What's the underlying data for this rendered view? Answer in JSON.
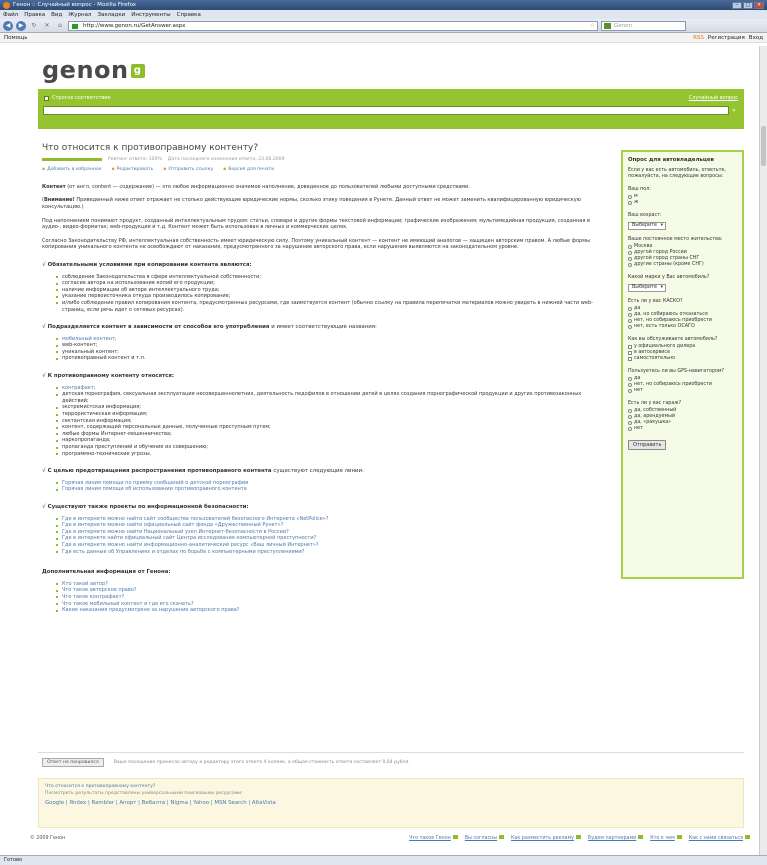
{
  "browser": {
    "window_title": "Генон :: Случайный вопрос - Mozilla Firefox",
    "menu": [
      "Файл",
      "Правка",
      "Вид",
      "Журнал",
      "Закладки",
      "Инструменты",
      "Справка"
    ],
    "url": "http://www.genon.ru/GetAnswer.aspx",
    "search_placeholder": "Genon",
    "status": "Готово"
  },
  "sitebar": {
    "help": "Помощь",
    "rss": "RSS",
    "register": "Регистрация",
    "login": "Вход"
  },
  "header": {
    "logo": "genon",
    "logo_mark": "g",
    "strict": "Строгое соответствие",
    "random": "Случайный вопрос"
  },
  "article": {
    "title": "Что относится к противоправному контенту?",
    "rating_text": "Рейтинг ответа: 100%",
    "updated": "Дата последнего изменения ответа: 23.06.2009",
    "actions": [
      "Добавить в избранное",
      "Редактировать",
      "Отправить ссылку",
      "Версия для печати"
    ],
    "intro_bold": "Контент",
    "intro": "(от англ. content — содержание) — это любое информационно значимое наполнение, доведенное до пользователей любыми доступными средствами.",
    "warning_bold": "Внимание!",
    "warning": "Приведенный ниже ответ отражает не столько действующие юридические нормы, сколько этику поведения в Рунете. Данный ответ не может заменить квалифицированную юридическую консультацию.)",
    "p3": "Под наполнением понимают продукт, созданный интеллектуальным трудом: статьи, словари и другие формы текстовой информации; графические изображения; мультимедийная продукция, созданная в аудио-, видео-форматах; web-продукция и т.д. Контент может быть использован в личных и коммерческих целях.",
    "p4": "Согласно Законодательству РФ, интеллектуальная собственность имеет юридическую силу. Поэтому уникальный контент — контент не имеющий аналогов — защищен авторским правом. А любые формы копирования уникального контента не освобождают от наказания, предусмотренного за нарушение авторского права, если нарушения выявляются на законодательном уровне.",
    "s1": "Обязательными условиями при копировании контента являются:",
    "s1_items": [
      "соблюдение Законодательства в сфере интеллектуальной собственности;",
      "согласие автора на использование копий его продукции;",
      "наличие информации об авторе интеллектуального труда;",
      "указание первоисточника откуда производилось копирование;",
      "и/либо соблюдение правил копирования контента, предусмотренных ресурсами, где заимствуется контент (обычно ссылку на правила перепечатки материалов можно увидеть в нижней части web-страниц, если речь идет о сетевых ресурсах)."
    ],
    "s2": "Подразделяется контент в зависимости от способов его употребления",
    "s2_tail": "и имеет соответствующие названия:",
    "s2_items": [
      "мобильный контент;",
      "web-контент;",
      "уникальный контент;",
      "противоправный контент и т.п."
    ],
    "s3": "К противоправному контенту относятся:",
    "s3_items": [
      "контрафакт;",
      "детская порнография, сексуальная эксплуатация несовершеннолетних, деятельность педофилов в отношении детей в целях создания порнографической продукции и других противозаконных действий;",
      "экстремистская информация;",
      "террористическая информация;",
      "сектантская информация;",
      "контент, содержащий персональные данные, полученные преступным путем;",
      "любые формы Интернет-мошенничества;",
      "наркопропаганда;",
      "пропаганда преступлений и обучение их совершению;",
      "программно-технические угрозы."
    ],
    "s4": "С целью предотвращения распространения противоправного контента",
    "s4_tail": "существуют следующие линии:",
    "s4_items": [
      "Горячая линия помощи по приему сообщений о детской порнографии",
      "Горячая линия помощи об использовании противоправного контента"
    ],
    "s5": "Существуют также проекты по информационной безопасности:",
    "s5_items": [
      "Где в интернете можно найти сайт сообщества пользователей безопасного Интернета «NetPolice»?",
      "Где в интернете можно найти официальный сайт фонда «Дружественный Рунет»?",
      "Где в интернете можно найти Национальный узел Интернет-безопасности в России?",
      "Где в интернете найти официальный сайт Центра исследования компьютерной преступности?",
      "Где в интернете можно найти информационно-аналитический ресурс «Ваш личный Интернет»?",
      "Где есть данные об Управлениях и отделах по борьбе с компьютерными преступлениями?"
    ],
    "extra": "Дополнительная информация от Генона:",
    "extra_items": [
      "Кто такой автор?",
      "Что такое авторское право?",
      "Что такое контрафакт?",
      "Что такое мобильный контент и где его скачать?",
      "Какие наказания предусмотрено за нарушение авторского права?"
    ]
  },
  "poll": {
    "title": "Опрос для автовладельцев",
    "intro": "Если у вас есть автомобиль, ответьте, пожалуйста, на следующие вопросы:",
    "q_gender": "Ваш пол:",
    "gender": [
      "м",
      "ж"
    ],
    "q_age": "Ваш возраст:",
    "select": "Выберите",
    "q_city": "Ваше постоянное место жительства:",
    "city": [
      "Москва",
      "другой город России",
      "другой город страны СНГ",
      "другие страны (кроме СНГ)"
    ],
    "q_brand": "Какой марки у Вас автомобиль?",
    "q_kasko": "Есть ли у вас КАСКО?",
    "kasko": [
      "да",
      "да, но собираюсь отказаться",
      "нет, но собираюсь приобрести",
      "нет, есть только ОСАГО"
    ],
    "q_service": "Как вы обслуживаете автомобиль?",
    "service": [
      "у официального дилера",
      "в автосервисе",
      "самостоятельно"
    ],
    "q_gps": "Пользуетесь ли вы GPS-навигатором?",
    "gps": [
      "да",
      "нет, но собираюсь приобрести",
      "нет"
    ],
    "q_garage": "Есть ли у вас гараж?",
    "garage": [
      "да, собственный",
      "да, арендуемый",
      "да, «ракушка»",
      "нет"
    ],
    "submit": "Отправить"
  },
  "bottom": {
    "reply_btn": "Ответ не понравился",
    "reply_text": "Ваше посещение принесло автору и редактору этого ответа 4 копеек, а общая стоимость ответа составляет 0,64 рубля.",
    "y1": "Что относится к противоправному контенту?",
    "y2": "Посмотреть результаты представлены универсальными поисковыми ресурсами:",
    "engines": "Google | Яndex | Rambler | Апорт | Вебалта | Nigma | Yahoo | MSN Search | AltaVista"
  },
  "footer": {
    "copy": "© 2009 Генон",
    "links": [
      "Что такое Генон",
      "Вы согласны",
      "Как разместить рекламу",
      "Будем партнерами",
      "Кто к чем",
      "Как с нами связаться"
    ]
  }
}
